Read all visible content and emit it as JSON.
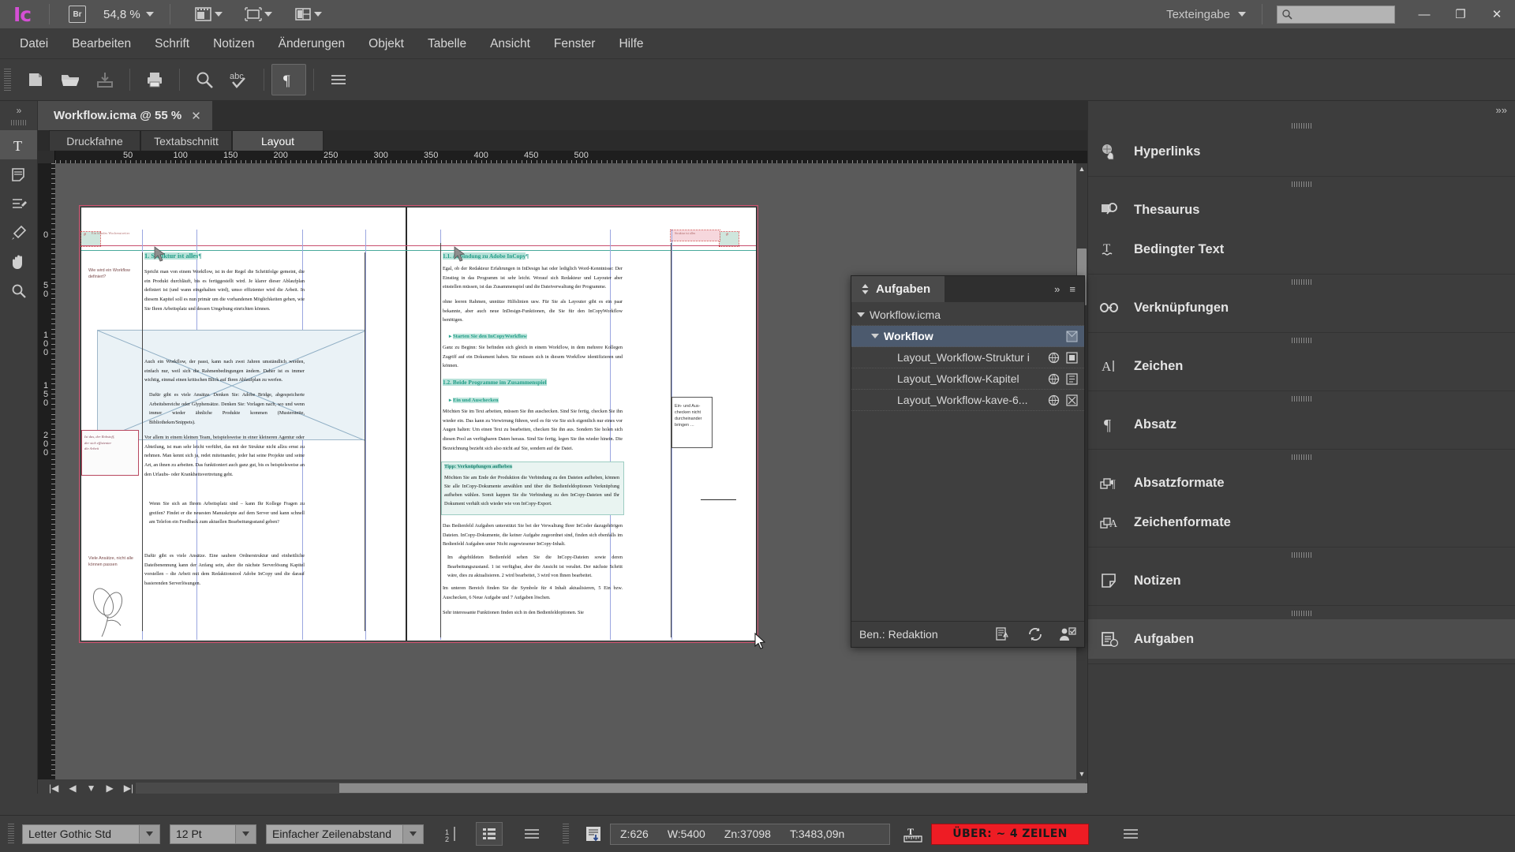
{
  "app": {
    "logo": "Ic",
    "bridge_badge": "Br",
    "zoom_level": "54,8 %",
    "workspace": "Texteingabe",
    "search_placeholder": "",
    "window_buttons": {
      "minimize": "—",
      "restore": "❐",
      "close": "✕"
    }
  },
  "menubar": {
    "items": [
      "Datei",
      "Bearbeiten",
      "Schrift",
      "Notizen",
      "Änderungen",
      "Objekt",
      "Tabelle",
      "Ansicht",
      "Fenster",
      "Hilfe"
    ]
  },
  "toolstrip": {
    "buttons": [
      {
        "name": "new-document",
        "label": "Neu"
      },
      {
        "name": "open-document",
        "label": "Öffnen"
      },
      {
        "name": "save-document",
        "label": "Speichern"
      },
      {
        "name": "print",
        "label": "Drucken"
      },
      {
        "name": "find-replace",
        "label": "Suchen/Ersetzen"
      },
      {
        "name": "spell-check",
        "label": "Rechtschreibprüfung"
      },
      {
        "name": "show-hidden-characters",
        "label": "Verborgene Zeichen"
      },
      {
        "name": "panel-menu",
        "label": "Menü"
      }
    ]
  },
  "left_tools": {
    "expand_label": "»",
    "items": [
      {
        "name": "type-tool",
        "glyph": "T",
        "active": true
      },
      {
        "name": "note-tool",
        "glyph": "note"
      },
      {
        "name": "track-changes-tool",
        "glyph": "changes"
      },
      {
        "name": "eyedropper-tool",
        "glyph": "eyedropper"
      },
      {
        "name": "hand-tool",
        "glyph": "hand"
      },
      {
        "name": "zoom-tool",
        "glyph": "zoom"
      }
    ]
  },
  "document": {
    "tab_title": "Workflow.icma @ 55 %",
    "close_glyph": "✕",
    "view_tabs": [
      {
        "label": "Druckfahne",
        "active": false
      },
      {
        "label": "Textabschnitt",
        "active": false
      },
      {
        "label": "Layout",
        "active": true
      }
    ],
    "ruler_h_labels": [
      "50",
      "100",
      "150",
      "200",
      "250",
      "300",
      "350",
      "400",
      "450",
      "500"
    ],
    "ruler_v_labels": [
      "0",
      "50",
      "100",
      "150",
      "200"
    ]
  },
  "page_content": {
    "left_page": {
      "heading": "1.  Struktur ist alles",
      "paragraphs": [
        "Spricht man von einem Workflow, ist in der Regel die Schrittfolge gemeint, die ein Produkt durchläuft, bis es fertiggestellt wird. Je klarer dieser Ab­laufplan definiert ist (und wann eingehalten wird), umso effizienter wird die Arbeit. In diesem Kapitel soll es nun primär um die vorhandenen Möglich­keiten gehen, wie Sie Ihren Arbeitsplatz und dessen Umgebung einrichten können.",
        "Auch ein Workflow, der passt, kann nach zwei Jahren umständlich werden, einfach nur, weil sich die Rahmenbedingungen ändern. Daher ist es immer wichtig, einmal einen kritischen Blick auf Ihren Ablaufplan zu werfen.",
        "Dafür gibt es viele Ansätze. Denken Sie: Adobe Bridge, abgespeicherte Arbeitsbereiche oder Glyphensätze. Denken Sie: Vorlagen nach, wo und wenn immer wieder ähnliche Produkte kommen (Mustersteite, Bibliotheken/Snippets).",
        "Vor allem in einem kleinen Team, beispielsweise in einer kleineren Agentur oder Abteilung, ist man sehr leicht verführt, das mit der Struktur nicht all­zu ernst zu nehmen. Man kennt sich ja, redet miteinander, jeder hat seine Projekte und seine Art, an ihnen zu arbeiten. Das funktioniert auch ganz gut, bis es beispielsweise an den Urlaubs- oder Krankheitsvertretung geht.",
        "Wenn Sie sich an Ihrem Arbeitsplatz sind – kann Ihr Kollege Fragen zu greifen? Findet er die neuesten Manuskripte auf dem Server und kann schnell am Telefon ein Feedback zum aktuellen Bearbeitungsstand geben?",
        "Dafür gibt es viele Ansätze. Eine saubere Ordnerstruktur und einheitli­che Dateibenennung kann der Anfang sein, aber die nächste Serverlösung Kapitel vorstellen – die Arbeit mit dem Redaktionstool Adobe InCopy und die darauf basierenden Serverlösungen."
      ],
      "margin_notes": [
        "Wie wird ein Work­flow definiert?",
        "Ist das, der Rohstoff, der sich effizienter die Arbeit?",
        "Viele Ansätze, nicht alle können passen"
      ]
    },
    "right_page": {
      "heading_1_1": "1.1.  Anbindung zu Adobe InCopy",
      "para_1": "Egal, ob der Redakteur Erfahrungen in InDesign hat oder lediglich Word-Kenntnisse: Der Einstieg in das Programm ist sehr leicht. Worauf sich Redakteur und Layouter aber einstellen müssen, ist das Zusammen­spiel und die Dateiverwaltung der Programme.",
      "para_2": "ohne leeren Rahmen, unnütze Hilfslinien usw. Für Sie als Layouter gibt es ein paar bekannte, aber auch neue InDesign-Funktionen, die Sie für den InCopyWorkflow benötigen.",
      "sub_1": "Starten Sie den InCopyWorkflow",
      "para_3": "Ganz zu Beginn: Sie befinden sich gleich in einem Workflow, in dem meh­rere Kollegen Zugriff auf ein Dokument haben. Sie müssen sich in diesem Workflow identifizieren und können.",
      "heading_1_2": "1.2.  Beide Programme im Zusammenspiel",
      "sub_2": "Ein und Auschecken",
      "para_4": "Möchten Sie im Text arbeiten, müssen Sie ihn auschecken. Sind Sie fertig, checken Sie ihn wieder ein. Das kann zu Verwirrung führen, weil es für vie Sie sich eigentlich nur eines vor Augen halten: Um einen Text zu bear­beiten, checken Sie ihn aus. Sondern Sie holen sich diesen Pool an verfügbaren Daten heraus. Sind Sie fertig, legen Sie ihn wieder hinein. Die Bezeichnung bezieht sich also nicht auf Sie, sondern auf die Datei.",
      "tip_title": "Tipp: Verknüpfungen aufheben",
      "tip_body": "Möchten Sie am Ende der Produktion die Verbindung zu den Dateien aufheben, können Sie alle InCopy-Dokumente anwählen und über die Bedienfeldoptionen Verknüpfung aufheben wählen. Somit kappen Sie die Verbindung zu den InCopy-Dateien und Ihr Dokument verhält sich wieder wie von InCopy-Export.",
      "para_5": "Das Bedienfeld Aufgaben unterstützt Sie bei der Verwaltung Ihrer InCoder dazugehörigen Dateien. InCopy-Dokumente, die keiner Aufgabe zugeord­net sind, finden sich ebenfalls im Bedienfeld Aufgaben unter Nicht zuge­wiesener InCopy-Inhalt.",
      "para_6": "Im abgebildeten Bedienfeld sehen Sie die InCopy-Dateien sowie deren Bearbeitungszustand. 1 ist verfügbar, aber die Ansicht ist veraltet. Der nächste Schritt wäre, dies zu aktualisieren. 2 wird bearbeitet, 3 wird von Ihnen bearbeitet.",
      "para_7": "Im unteren Bereich finden Sie die Symbole für 4 Inhalt aktualisieren, 5 Ein bzw. Auschecken, 6 Neue Aufgabe und 7 Aufgaben löschen.",
      "para_8": "Sehr interessante Funktionen finden sich in den Bedienfeldoptionen. Sie",
      "margin_note": "Ein- und Aus­checken nicht durcheinander bringen …"
    }
  },
  "right_dock": {
    "collapse_glyph": "»»",
    "groups": [
      {
        "items": [
          {
            "label": "Hyperlinks",
            "icon": "hyperlinks-icon",
            "active": false
          }
        ]
      },
      {
        "items": [
          {
            "label": "Thesaurus",
            "icon": "thesaurus-icon",
            "active": false
          },
          {
            "label": "Bedingter Text",
            "icon": "conditional-text-icon",
            "active": false
          }
        ]
      },
      {
        "items": [
          {
            "label": "Verknüpfungen",
            "icon": "links-icon",
            "active": false
          }
        ]
      },
      {
        "items": [
          {
            "label": "Zeichen",
            "icon": "character-icon",
            "active": false
          }
        ]
      },
      {
        "items": [
          {
            "label": "Absatz",
            "icon": "paragraph-icon",
            "active": false
          }
        ]
      },
      {
        "items": [
          {
            "label": "Absatzformate",
            "icon": "paragraph-styles-icon",
            "active": false
          },
          {
            "label": "Zeichenformate",
            "icon": "character-styles-icon",
            "active": false
          }
        ]
      },
      {
        "items": [
          {
            "label": "Notizen",
            "icon": "notes-icon",
            "active": false
          }
        ]
      },
      {
        "items": [
          {
            "label": "Aufgaben",
            "icon": "assignments-icon",
            "active": true
          }
        ]
      }
    ]
  },
  "assignments_panel": {
    "tab_label": "Aufgaben",
    "menu_glyph": "≡",
    "collapse_glyph": "»",
    "rows": [
      {
        "label": "Workflow.icma",
        "indent": 0,
        "bold": false,
        "selected": false,
        "triangle": true,
        "icons": []
      },
      {
        "label": "Workflow",
        "indent": 1,
        "bold": true,
        "selected": true,
        "triangle": true,
        "icons": [
          "assignment-package-icon"
        ]
      },
      {
        "label": "Layout_Workflow-Struktur i",
        "indent": 2,
        "bold": false,
        "selected": false,
        "triangle": false,
        "icons": [
          "available-icon",
          "outdated-icon"
        ]
      },
      {
        "label": "Layout_Workflow-Kapitel",
        "indent": 2,
        "bold": false,
        "selected": false,
        "triangle": false,
        "icons": [
          "available-icon",
          "editing-icon"
        ]
      },
      {
        "label": "Layout_Workflow-kave-6...",
        "indent": 2,
        "bold": false,
        "selected": false,
        "triangle": false,
        "icons": [
          "available-icon",
          "checked-out-icon"
        ]
      }
    ],
    "footer": {
      "user_label": "Ben.: Redaktion",
      "icons": [
        "update-content-icon",
        "check-in-out-icon",
        "new-assignment-icon"
      ]
    }
  },
  "statusbar": {
    "font_family": "Letter Gothic Std",
    "font_size": "12 Pt",
    "leading": "Einfacher Zeilenabstand",
    "info": {
      "z": "Z:626",
      "w": "W:5400",
      "zn": "Zn:37098",
      "t": "T:3483,09n"
    },
    "overset_text": "ÜBER:  ~ 4 ZEILEN",
    "icons": [
      "paragraph-align-icon",
      "list-icon",
      "menu-icon",
      "text-flow-icon",
      "text-measure-icon",
      "status-menu-icon"
    ]
  },
  "colors": {
    "chrome": "#3d3d3d",
    "titlebar": "#535353",
    "canvas": "#5a5a5a",
    "accent_magenta": "#d44fd4",
    "heading_green": "#1f9c86",
    "overset_red": "#ee1c24",
    "selection_blue": "#4c5a6e",
    "bleed_pink": "#d14f6e"
  }
}
